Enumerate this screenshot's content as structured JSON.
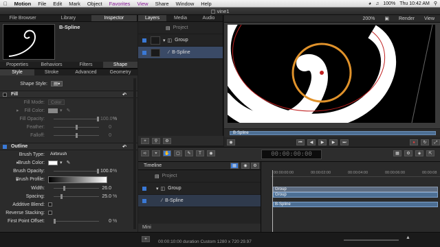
{
  "menubar": {
    "app": "Motion",
    "items": [
      "File",
      "Edit",
      "Mark",
      "Object",
      "Favorites",
      "View",
      "Share",
      "Window",
      "Help"
    ],
    "clock": "Thu 10:42 AM",
    "battery": "100%"
  },
  "window": {
    "title": "vine1"
  },
  "left": {
    "tabs": [
      "File Browser",
      "Library",
      "Inspector"
    ],
    "active_tab": "Inspector",
    "preview_name": "B-Spline",
    "tabs2": [
      "Properties",
      "Behaviors",
      "Filters",
      "Shape"
    ],
    "active_tab2": "Shape",
    "subtabs": [
      "Style",
      "Stroke",
      "Advanced",
      "Geometry"
    ],
    "shape_style_label": "Shape Style:",
    "fill": {
      "title": "Fill",
      "fill_mode_label": "Fill Mode:",
      "fill_mode_value": "Color",
      "fill_color_label": "Fill Color:",
      "fill_opacity_label": "Fill Opacity:",
      "fill_opacity_value": "100.0",
      "feather_label": "Feather:",
      "feather_value": "0",
      "falloff_label": "Falloff:",
      "falloff_value": "0"
    },
    "outline": {
      "title": "Outline",
      "brush_type_label": "Brush Type:",
      "brush_type_value": "Airbrush",
      "brush_color_label": "Brush Color:",
      "brush_opacity_label": "Brush Opacity:",
      "brush_opacity_value": "100.0",
      "brush_profile_label": "Brush Profile:",
      "width_label": "Width:",
      "width_value": "26.0",
      "spacing_label": "Spacing:",
      "spacing_value": "25.0",
      "additive_label": "Additive Blend:",
      "reverse_label": "Reverse Stacking:",
      "first_point_label": "First Point Offset:",
      "first_point_value": "0",
      "percent": "%"
    }
  },
  "layers": {
    "tabs": [
      "Layers",
      "Media",
      "Audio"
    ],
    "active": "Layers",
    "project": "Project",
    "group": "Group",
    "bspline": "B-Spline"
  },
  "canvas": {
    "zoom": "200%",
    "render": "Render",
    "view": "View"
  },
  "minitimeline": {
    "label": "B-Spline"
  },
  "timecode": "00:00:00:00",
  "timeline": {
    "title": "Timeline",
    "project": "Project",
    "group": "Group",
    "bspline": "B-Spline",
    "mini": "Mini",
    "ruler": [
      "00:00:00:00",
      "00:00:02:00",
      "00:00:04:00",
      "00:00:06:00",
      "00:00:08"
    ],
    "bar_group": "Group",
    "bar_group2": "Group",
    "bar_spline": "B-Spline"
  },
  "status": {
    "text": "00:00:10:00 duration Custom 1280 x 720 29.97"
  },
  "colors": {
    "circle": "#e0922b",
    "redline": "#c02020",
    "selection": "#3a4a66",
    "accent": "#3a79d6"
  }
}
